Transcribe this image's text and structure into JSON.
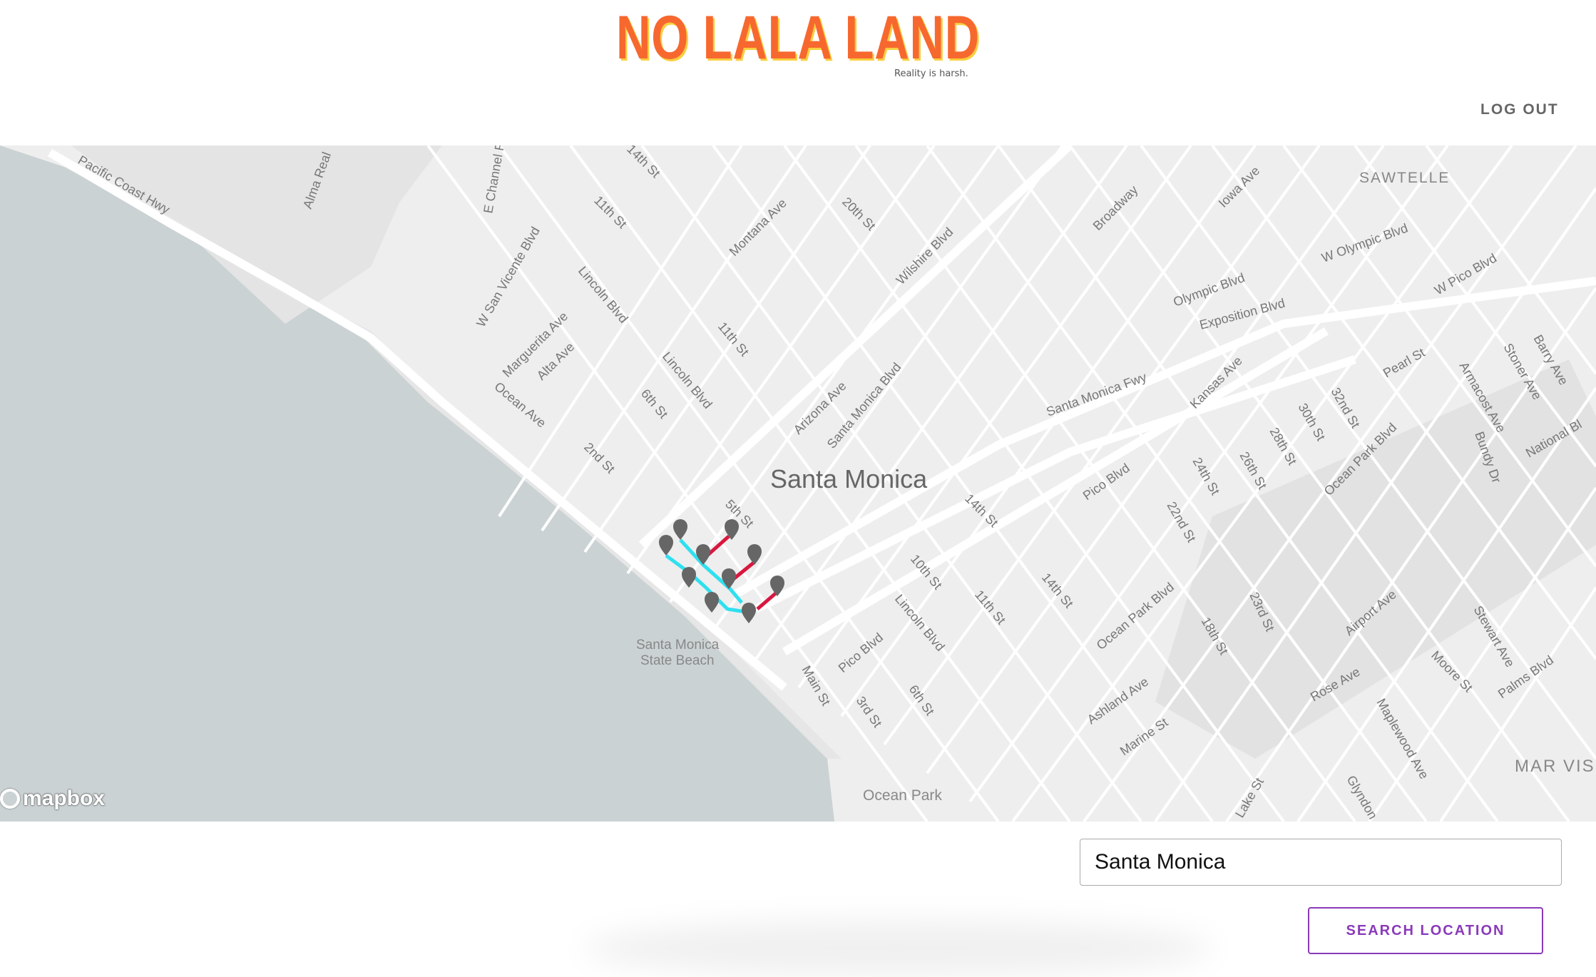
{
  "header": {
    "logo_text": "NO LALA LAND",
    "tagline": "Reality is harsh.",
    "logout_label": "LOG OUT"
  },
  "map": {
    "city_label": "Santa Monica",
    "attribution": "mapbox",
    "place_labels": [
      {
        "text": "SAWTELLE"
      },
      {
        "text": "MAR VIS"
      },
      {
        "text": "Santa Monica"
      },
      {
        "text": "State Beach"
      },
      {
        "text": "Ocean Park"
      }
    ],
    "street_labels": [
      "Pacific Coast Hwy",
      "Alma Real",
      "E Channel R",
      "14th St",
      "11th St",
      "Montana Ave",
      "20th St",
      "Wilshire Blvd",
      "Broadway",
      "Iowa Ave",
      "W San Vicente Blvd",
      "Lincoln Blvd",
      "Marguerita Ave",
      "Alta Ave",
      "11th St",
      "Lincoln Blvd",
      "6th St",
      "Ocean Ave",
      "2nd St",
      "Arizona Ave",
      "Santa Monica Blvd",
      "Olympic Blvd",
      "W Olympic Blvd",
      "W Pico Blvd",
      "Exposition Blvd",
      "Santa Monica Fwy",
      "Kansas Ave",
      "Pearl St",
      "32nd St",
      "30th St",
      "28th St",
      "26th St",
      "24th St",
      "22nd St",
      "Pico Blvd",
      "14th St",
      "Ocean Park Blvd",
      "Armacost Ave",
      "Stoner Ave",
      "Barry Ave",
      "Bundy Dr",
      "National Bl",
      "5th St",
      "10th St",
      "11th St",
      "14th St",
      "Lincoln Blvd",
      "Pico Blvd",
      "Main St",
      "3rd St",
      "6th St",
      "Ocean Park Blvd",
      "18th St",
      "23rd St",
      "Ashland Ave",
      "Marine St",
      "Airport Ave",
      "Rose Ave",
      "Stewart Ave",
      "Moore St",
      "Palms Blvd",
      "Maplewood Ave",
      "Lake St",
      "Glyndon"
    ],
    "route_colors": {
      "cyan": "#2fe0ef",
      "red": "#d8173f"
    },
    "marker_color": "#666666",
    "water_color": "#cbd2d3",
    "land_color": "#eeeeee"
  },
  "search": {
    "value": "Santa Monica",
    "button_label": "SEARCH LOCATION"
  }
}
